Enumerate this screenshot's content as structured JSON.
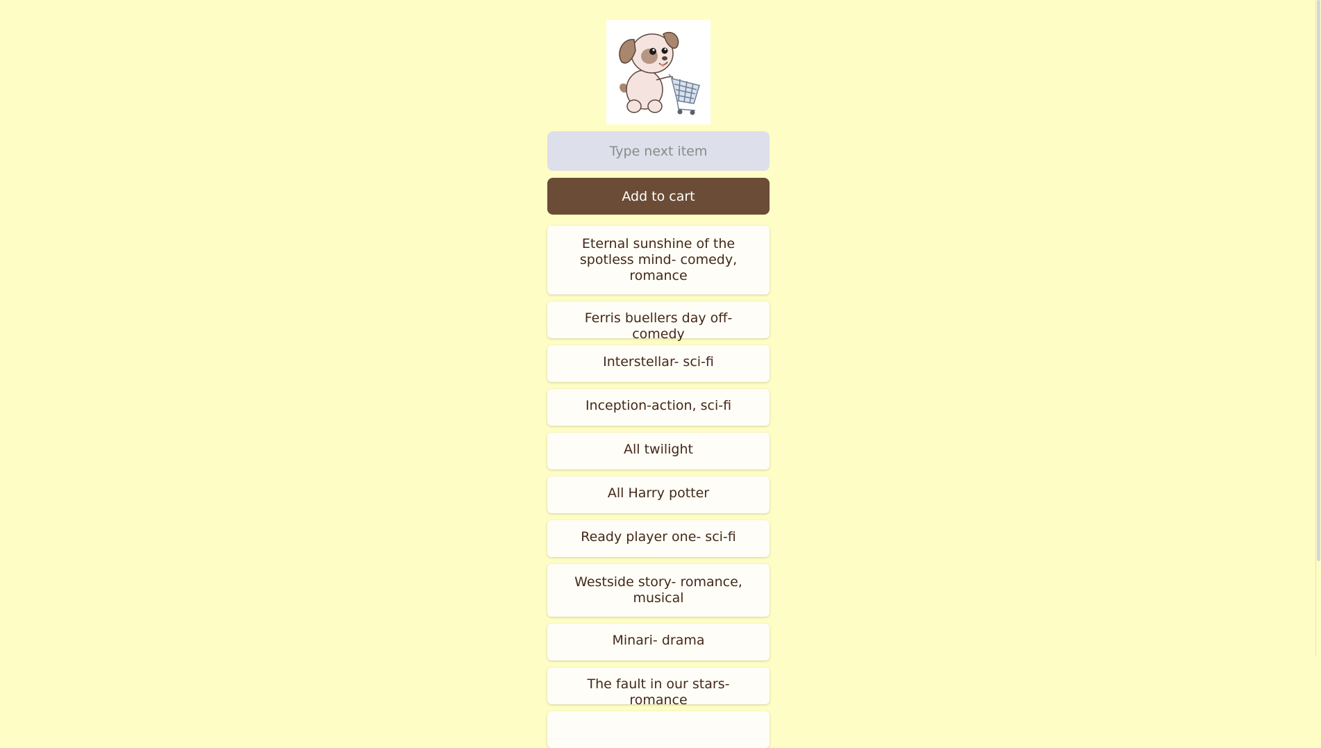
{
  "logo": {
    "alt": "Dog pushing shopping cart"
  },
  "input": {
    "placeholder": "Type next item",
    "value": ""
  },
  "add_button": {
    "label": "Add to cart"
  },
  "items": [
    "Eternal sunshine of the spotless mind- comedy, romance",
    "Ferris buellers day off- comedy",
    "Interstellar- sci-fi",
    "Inception-action, sci-fi",
    "All twilight",
    "All Harry potter",
    "Ready player one- sci-fi",
    "Westside story- romance, musical",
    "Minari- drama",
    "The fault in our stars- romance"
  ],
  "colors": {
    "background": "#fefdc5",
    "button": "#6b4c37",
    "input": "#dde0ea",
    "item_text": "#432818"
  }
}
